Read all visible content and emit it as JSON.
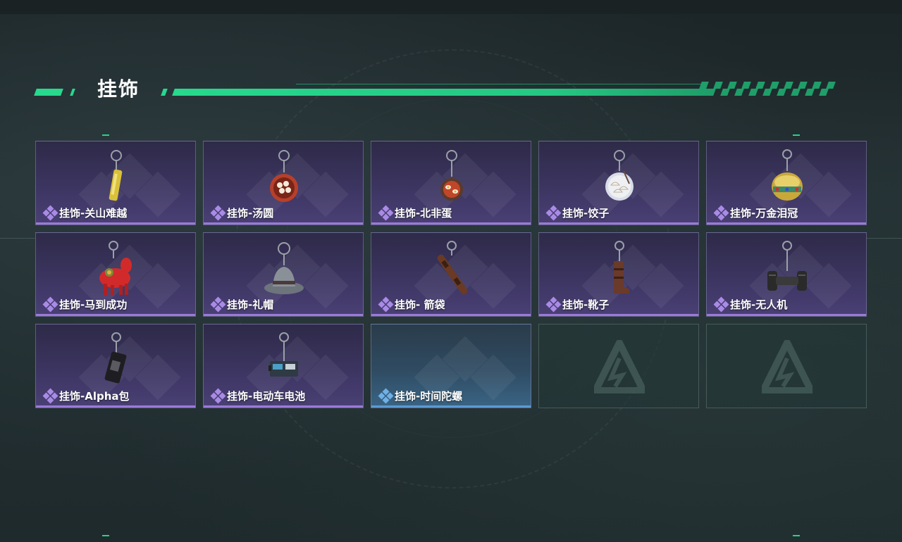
{
  "section": {
    "title": "挂饰"
  },
  "colors": {
    "accent": "#27d88d",
    "rarity_purple": "#9b7ad8",
    "rarity_blue": "#5a9ad4"
  },
  "cards": [
    {
      "name": "挂饰-关山难越",
      "rarity": "purple",
      "icon": "golden-cylinder-charm-icon"
    },
    {
      "name": "挂饰-汤圆",
      "rarity": "purple",
      "icon": "tangyuan-bowl-charm-icon"
    },
    {
      "name": "挂饰-北非蛋",
      "rarity": "purple",
      "icon": "shakshuka-pan-charm-icon"
    },
    {
      "name": "挂饰-饺子",
      "rarity": "purple",
      "icon": "dumpling-plate-charm-icon"
    },
    {
      "name": "挂饰-万金泪冠",
      "rarity": "purple",
      "icon": "jeweled-crown-charm-icon"
    },
    {
      "name": "挂饰-马到成功",
      "rarity": "purple",
      "icon": "red-horse-charm-icon"
    },
    {
      "name": "挂饰-礼帽",
      "rarity": "purple",
      "icon": "fedora-hat-charm-icon"
    },
    {
      "name": "挂饰- 箭袋",
      "rarity": "purple",
      "icon": "quiver-charm-icon"
    },
    {
      "name": "挂饰-靴子",
      "rarity": "purple",
      "icon": "boot-charm-icon"
    },
    {
      "name": "挂饰-无人机",
      "rarity": "purple",
      "icon": "drone-charm-icon"
    },
    {
      "name": "挂饰-Alpha包",
      "rarity": "purple",
      "icon": "black-pouch-charm-icon"
    },
    {
      "name": "挂饰-电动车电池",
      "rarity": "purple",
      "icon": "ev-battery-charm-icon"
    },
    {
      "name": "挂饰-时间陀螺",
      "rarity": "blue",
      "icon": ""
    },
    {
      "name": "",
      "rarity": "empty",
      "icon": "delta-logo-icon"
    },
    {
      "name": "",
      "rarity": "empty",
      "icon": "delta-logo-icon"
    }
  ]
}
